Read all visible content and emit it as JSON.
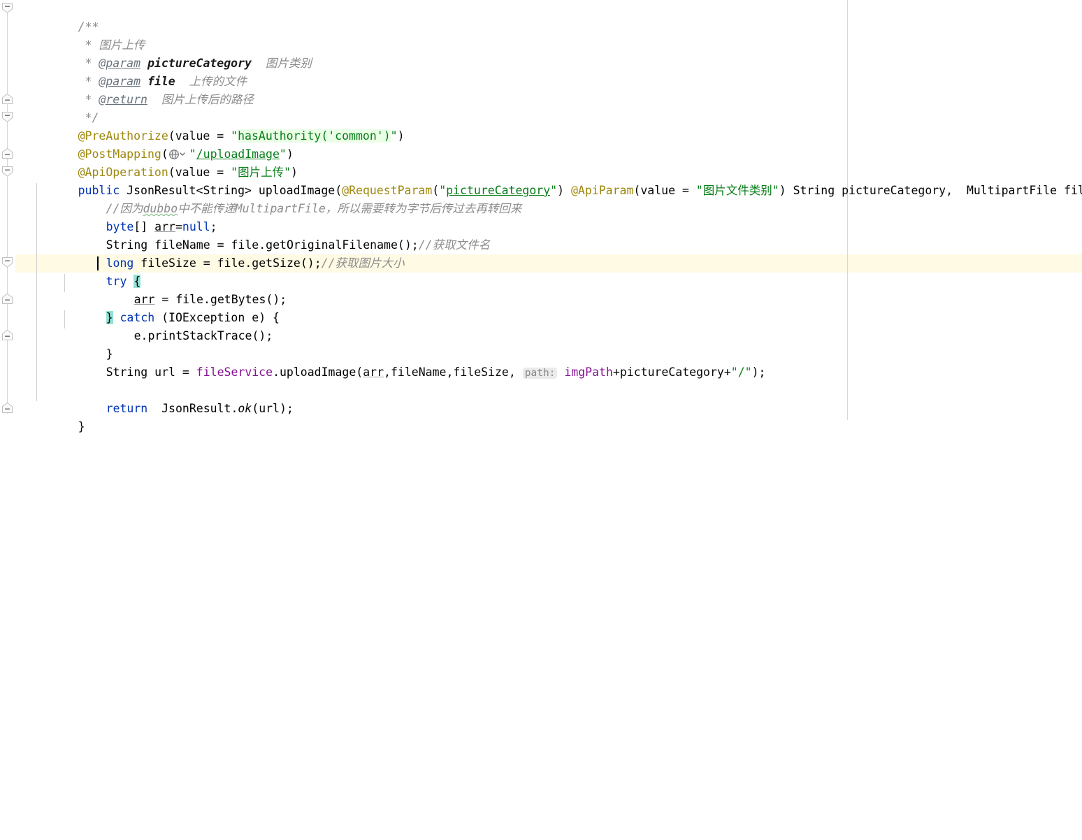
{
  "editor": {
    "language": "java",
    "font_size_px": 16.5,
    "line_height_px": 26,
    "gutter": {
      "fold_markers": [
        {
          "type": "fold-start",
          "line": 0
        },
        {
          "type": "fold-end",
          "line": 5
        },
        {
          "type": "fold-start",
          "line": 6
        },
        {
          "type": "fold-end",
          "line": 8
        },
        {
          "type": "fold-start",
          "line": 9
        },
        {
          "type": "fold-start",
          "line": 14
        },
        {
          "type": "fold-end",
          "line": 16
        },
        {
          "type": "fold-end",
          "line": 18
        },
        {
          "type": "fold-end",
          "line": 22
        }
      ]
    },
    "current_line_index": 14,
    "caret_line_index": 14,
    "right_margin_column_x": 1212
  },
  "colors": {
    "background": "#ffffff",
    "keyword": "#0033b3",
    "string": "#067d17",
    "annotation": "#9e880d",
    "comment": "#8c8c8c",
    "field": "#871094",
    "number": "#1750eb",
    "current_line_bg": "#fffae3",
    "brace_match_bg": "#93e0d4",
    "injected_string_bg": "#eaffe6",
    "inlay_hint_bg": "#eaeaea",
    "inlay_hint_fg": "#868686",
    "indent_guide": "#cfcfcf",
    "right_margin": "#d8d8d8",
    "caret": "#000000"
  },
  "code": {
    "lines": [
      {
        "id": "javadoc-open",
        "text": "/**"
      },
      {
        "id": "javadoc-summary",
        "text": " * 图片上传"
      },
      {
        "id": "javadoc-param-1",
        "text": " * @param pictureCategory 图片类别"
      },
      {
        "id": "javadoc-param-2",
        "text": " * @param file 上传的文件"
      },
      {
        "id": "javadoc-return",
        "text": " * @return 图片上传后的路径"
      },
      {
        "id": "javadoc-close",
        "text": " */"
      },
      {
        "id": "anno-preauthorize",
        "text": "@PreAuthorize(value = \"hasAuthority('common')\")"
      },
      {
        "id": "anno-postmapping",
        "text": "@PostMapping(\"/uploadImage\")"
      },
      {
        "id": "anno-apioperation",
        "text": "@ApiOperation(value = \"图片上传\")"
      },
      {
        "id": "method-signature",
        "text": "public JsonResult<String> uploadImage(@RequestParam(\"pictureCategory\") @ApiParam(value = \"图片文件类别\") String pictureCategory,  MultipartFile file){"
      },
      {
        "id": "comment-dubbo",
        "text": "    //因为dubbo中不能传递MultipartFile，所以需要转为字节后传过去再转回来"
      },
      {
        "id": "decl-arr",
        "text": "    byte[] arr=null;"
      },
      {
        "id": "decl-filename",
        "text": "    String fileName = file.getOriginalFilename();//获取文件名"
      },
      {
        "id": "decl-filesize",
        "text": "    long fileSize = file.getSize();//获取图片大小"
      },
      {
        "id": "try-open",
        "text": "    try {"
      },
      {
        "id": "assign-arr",
        "text": "        arr = file.getBytes();"
      },
      {
        "id": "catch-open",
        "text": "    } catch (IOException e) {"
      },
      {
        "id": "print-stacktrace",
        "text": "        e.printStackTrace();"
      },
      {
        "id": "catch-close",
        "text": "    }"
      },
      {
        "id": "call-uploadimage",
        "text": "    String url = fileService.uploadImage(arr,fileName,fileSize, imgPath+pictureCategory+\"/\");"
      },
      {
        "id": "blank",
        "text": ""
      },
      {
        "id": "return-stmt",
        "text": "    return  JsonResult.ok(url);"
      },
      {
        "id": "method-close",
        "text": "}"
      }
    ],
    "tokens": {
      "javadoc_open": "/**",
      "javadoc_star": " * ",
      "javadoc_summary_text": "图片上传",
      "tag_param": "@param",
      "tag_return": "@return",
      "param_name_1": "pictureCategory",
      "param_desc_1": "图片类别",
      "param_name_2": "file",
      "param_desc_2": "上传的文件",
      "return_desc": "图片上传后的路径",
      "javadoc_close": " */",
      "anno_preauthorize": "@PreAuthorize",
      "value_eq": "value = ",
      "preauthorize_expr": "hasAuthority('common')",
      "preauthorize_outer": "hasAuthority(",
      "preauthorize_inner": "'common'",
      "preauthorize_tail": ")",
      "anno_postmapping": "@PostMapping",
      "postmapping_path": "/uploadImage",
      "anno_apioperation": "@ApiOperation",
      "apioperation_value": "图片上传",
      "kw_public": "public",
      "type_jsonresult": "JsonResult",
      "generic_open": "<",
      "type_string_generic": "String",
      "generic_close": ">",
      "method_name": "uploadImage",
      "anno_requestparam": "@RequestParam",
      "requestparam_value": "pictureCategory",
      "anno_apiparam": "@ApiParam",
      "apiparam_value": "图片文件类别",
      "type_string": "String",
      "param_picturecategory": "pictureCategory",
      "type_multipartfile": "MultipartFile",
      "param_file": "file",
      "comment_dubbo_pre": "//因为",
      "comment_dubbo_typo": "dubbo",
      "comment_dubbo_post": "中不能传递MultipartFile，所以需要转为字节后传过去再转回来",
      "kw_byte": "byte",
      "var_arr": "arr",
      "kw_null": "null",
      "var_filename": "fileName",
      "var_file": "file",
      "mth_getoriginalfilename": "getOriginalFilename",
      "cmt_filename": "//获取文件名",
      "kw_long": "long",
      "var_filesize": "fileSize",
      "mth_getsize": "getSize",
      "cmt_filesize": "//获取图片大小",
      "kw_try": "try",
      "brace_open": "{",
      "brace_close": "}",
      "mth_getbytes": "getBytes",
      "kw_catch": "catch",
      "type_ioexception": "IOException",
      "var_e": "e",
      "mth_printstacktrace": "printStackTrace",
      "var_url": "url",
      "field_fileservice": "fileService",
      "mth_uploadimage": "uploadImage",
      "inlay_path": "path:",
      "field_imgpath": "imgPath",
      "str_slash": "/",
      "kw_return": "return",
      "type_jsonresult_ret": "JsonResult",
      "mth_ok": "ok"
    }
  },
  "icons": {
    "globe": "globe-icon",
    "chevron_down": "chevron-down-icon",
    "fold_minus": "fold-minus-icon"
  }
}
